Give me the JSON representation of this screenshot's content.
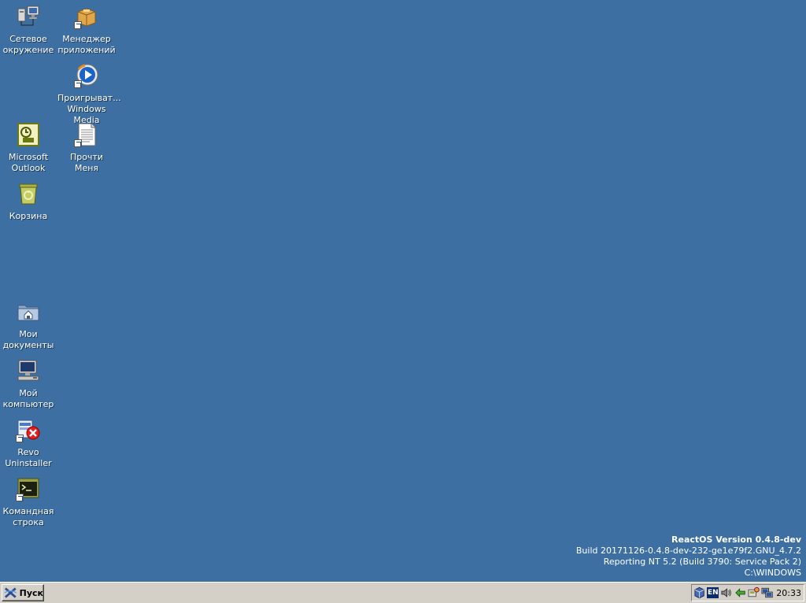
{
  "desktop": {
    "icons": [
      {
        "id": "network",
        "label": "Сетевое\nокружение",
        "icon": "network-icon"
      },
      {
        "id": "appmgr",
        "label": "Менеджер\nприложений",
        "icon": "package-icon"
      },
      {
        "id": "wmp",
        "label": "Проигрыват...\nWindows Media",
        "icon": "media-player-icon"
      },
      {
        "id": "outlook",
        "label": "Microsoft\nOutlook",
        "icon": "outlook-icon"
      },
      {
        "id": "readme",
        "label": "Прочти\nМеня",
        "icon": "document-icon"
      },
      {
        "id": "recycle",
        "label": "Корзина",
        "icon": "recycle-bin-icon"
      },
      {
        "id": "mydocs",
        "label": "Мои\nдокументы",
        "icon": "folder-icon"
      },
      {
        "id": "mycomp",
        "label": "Мой\nкомпьютер",
        "icon": "computer-icon"
      },
      {
        "id": "revo",
        "label": "Revo\nUninstaller",
        "icon": "uninstaller-icon"
      },
      {
        "id": "cmd",
        "label": "Командная\nстрока",
        "icon": "terminal-icon"
      }
    ]
  },
  "version": {
    "title": "ReactOS Version 0.4.8-dev",
    "build": "Build 20171126-0.4.8-dev-232-ge1e79f2.GNU_4.7.2",
    "reporting": "Reporting NT 5.2 (Build 3790: Service Pack 2)",
    "path": "C:\\WINDOWS"
  },
  "taskbar": {
    "start_label": "Пуск",
    "language": "EN",
    "clock": "20:33"
  },
  "colors": {
    "desktop": "#3d6fa3",
    "taskbar": "#d4d0c8"
  }
}
